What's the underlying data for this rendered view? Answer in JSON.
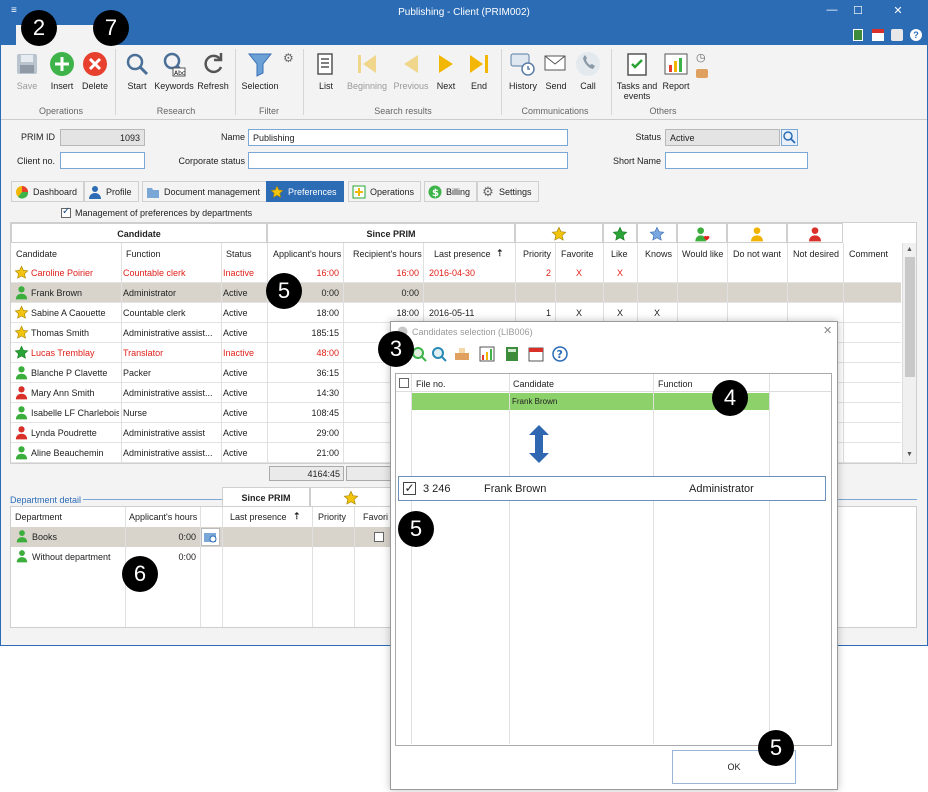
{
  "window": {
    "title": "Publishing - Client (PRIM002)"
  },
  "ribbon": {
    "groups": [
      {
        "name": "Operations",
        "buttons": [
          {
            "label": "Save",
            "icon": "save-icon",
            "disabled": true
          },
          {
            "label": "Insert",
            "icon": "plus-icon"
          },
          {
            "label": "Delete",
            "icon": "delete-icon"
          }
        ]
      },
      {
        "name": "Research",
        "buttons": [
          {
            "label": "Start",
            "icon": "search-icon"
          },
          {
            "label": "Keywords",
            "icon": "keyword-search-icon"
          },
          {
            "label": "Refresh",
            "icon": "refresh-icon"
          }
        ]
      },
      {
        "name": "Filter",
        "buttons": [
          {
            "label": "Selection",
            "icon": "filter-icon"
          }
        ]
      },
      {
        "name": "Search results",
        "buttons": [
          {
            "label": "List",
            "icon": "list-icon"
          },
          {
            "label": "Beginning",
            "icon": "first-icon",
            "disabled": true
          },
          {
            "label": "Previous",
            "icon": "previous-icon",
            "disabled": true
          },
          {
            "label": "Next",
            "icon": "next-icon"
          },
          {
            "label": "End",
            "icon": "last-icon"
          }
        ]
      },
      {
        "name": "Communications",
        "buttons": [
          {
            "label": "History",
            "icon": "history-icon"
          },
          {
            "label": "Send",
            "icon": "send-icon"
          },
          {
            "label": "Call",
            "icon": "phone-icon"
          }
        ]
      },
      {
        "name": "Others",
        "buttons": [
          {
            "label": "Tasks and events",
            "label_line1": "Tasks and",
            "label_line2": "events",
            "icon": "tasks-icon"
          },
          {
            "label": "Report",
            "icon": "report-icon"
          }
        ]
      }
    ]
  },
  "form": {
    "prim_id_label": "PRIM ID",
    "prim_id_value": "1093",
    "client_no_label": "Client no.",
    "client_no_value": "",
    "name_label": "Name",
    "name_value": "Publishing",
    "corporate_status_label": "Corporate status",
    "corporate_status_value": "",
    "status_label": "Status",
    "status_value": "Active",
    "short_name_label": "Short Name",
    "short_name_value": ""
  },
  "tabs": [
    {
      "label": "Dashboard",
      "icon": "dashboard-icon"
    },
    {
      "label": "Profile",
      "icon": "profile-icon"
    },
    {
      "label": "Document management",
      "icon": "folder-icon"
    },
    {
      "label": "Preferences",
      "icon": "star-icon",
      "active": true
    },
    {
      "label": "Operations",
      "icon": "operations-icon"
    },
    {
      "label": "Billing",
      "icon": "dollar-icon"
    },
    {
      "label": "Settings",
      "icon": "gear-icon"
    }
  ],
  "preferences": {
    "management_by_departments_label": "Management of preferences by departments",
    "management_by_departments_checked": true,
    "group_headers": {
      "candidate": "Candidate",
      "since_prim": "Since PRIM"
    },
    "columns": [
      "Candidate",
      "Function",
      "Status",
      "Applicant's hours",
      "Recipient's hours",
      "Last presence",
      "Priority",
      "Favorite",
      "Like",
      "Knows",
      "Would like",
      "Do not want",
      "Not desired",
      "Comment"
    ],
    "rows": [
      {
        "icon": "yellow-star-icon",
        "candidate": "Caroline Poirier",
        "function": "Countable clerk",
        "status": "Inactive",
        "applicant_hours": "16:00",
        "recipient_hours": "16:00",
        "last_presence": "2016-04-30",
        "priority": "2",
        "favorite": "X",
        "like": "X",
        "knows": "",
        "red": true
      },
      {
        "icon": "green-person-icon",
        "candidate": "Frank Brown",
        "function": "Administrator",
        "status": "Active",
        "applicant_hours": "0:00",
        "recipient_hours": "0:00",
        "last_presence": "",
        "priority": "",
        "favorite": "",
        "like": "",
        "knows": "",
        "selected": true
      },
      {
        "icon": "yellow-star-icon",
        "candidate": "Sabine A Caouette",
        "function": "Countable clerk",
        "status": "Active",
        "applicant_hours": "18:00",
        "recipient_hours": "18:00",
        "last_presence": "2016-05-11",
        "priority": "1",
        "favorite": "X",
        "like": "X",
        "knows": "X"
      },
      {
        "icon": "yellow-star-icon",
        "candidate": "Thomas Smith",
        "function": "Administrative assist...",
        "status": "Active",
        "applicant_hours": "185:15",
        "recipient_hours": "",
        "last_presence": "",
        "priority": "",
        "favorite": "",
        "like": "",
        "knows": ""
      },
      {
        "icon": "green-star-icon",
        "candidate": "Lucas Tremblay",
        "function": "Translator",
        "status": "Inactive",
        "applicant_hours": "48:00",
        "recipient_hours": "",
        "last_presence": "",
        "priority": "",
        "favorite": "",
        "like": "",
        "knows": "",
        "red": true
      },
      {
        "icon": "green-person-icon",
        "candidate": "Blanche P Clavette",
        "function": "Packer",
        "status": "Active",
        "applicant_hours": "36:15",
        "recipient_hours": "",
        "last_presence": "",
        "priority": "",
        "favorite": "",
        "like": "",
        "knows": ""
      },
      {
        "icon": "red-person-icon",
        "candidate": "Mary Ann Smith",
        "function": "Administrative assist...",
        "status": "Active",
        "applicant_hours": "14:30",
        "recipient_hours": "",
        "last_presence": "",
        "priority": "",
        "favorite": "",
        "like": "",
        "knows": ""
      },
      {
        "icon": "green-person-icon",
        "candidate": "Isabelle LF Charlebois",
        "function": "Nurse",
        "status": "Active",
        "applicant_hours": "108:45",
        "recipient_hours": "",
        "last_presence": "",
        "priority": "",
        "favorite": "",
        "like": "",
        "knows": ""
      },
      {
        "icon": "red-person-icon",
        "candidate": "Lynda Poudrette",
        "function": "Administrative assist",
        "status": "Active",
        "applicant_hours": "29:00",
        "recipient_hours": "",
        "last_presence": "",
        "priority": "",
        "favorite": "",
        "like": "",
        "knows": ""
      },
      {
        "icon": "green-person-icon",
        "candidate": "Aline Beauchemin",
        "function": "Administrative assist...",
        "status": "Active",
        "applicant_hours": "21:00",
        "recipient_hours": "",
        "last_presence": "",
        "priority": "",
        "favorite": "",
        "like": "",
        "knows": ""
      }
    ],
    "total_applicant_hours": "4164:45"
  },
  "department_detail": {
    "title": "Department detail",
    "since_prim_header": "Since PRIM",
    "columns": [
      "Department",
      "Applicant's hours",
      "Last presence",
      "Priority",
      "Favori"
    ],
    "rows": [
      {
        "department": "Books",
        "applicant_hours": "0:00"
      },
      {
        "department": "Without department",
        "applicant_hours": "0:00"
      }
    ]
  },
  "dialog": {
    "title": "Candidates selection (LIB006)",
    "columns": [
      "File no.",
      "Candidate",
      "Function"
    ],
    "row": {
      "file_no": "",
      "candidate": "Frank Brown",
      "function": ""
    },
    "zoom_row": {
      "file_no": "3 246",
      "candidate": "Frank Brown",
      "function": "Administrator"
    },
    "ok_label": "OK"
  },
  "callouts": [
    "2",
    "7",
    "5",
    "3",
    "4",
    "5",
    "6",
    "5"
  ],
  "colors": {
    "accent": "#2b6cb5",
    "selection_green": "#8dd16a",
    "inactive_red": "#e0201a"
  }
}
